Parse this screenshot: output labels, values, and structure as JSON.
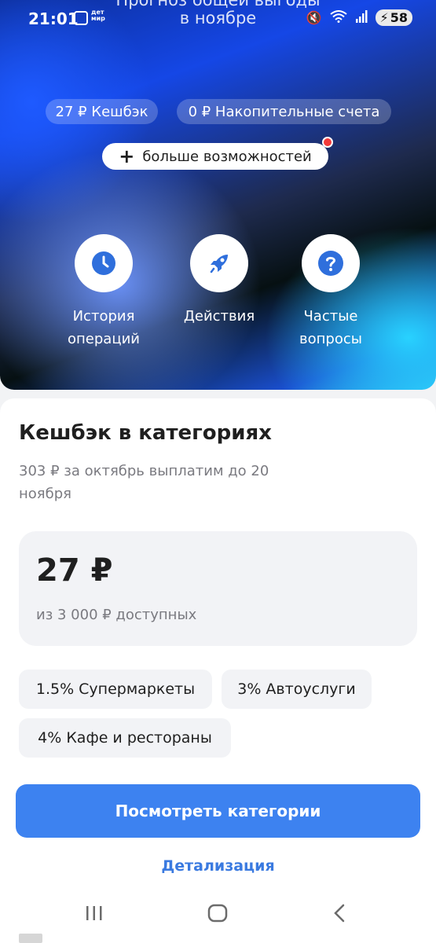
{
  "status_bar": {
    "time": "21:01",
    "logo_text": "дет мир",
    "battery": "58"
  },
  "behind_text": {
    "line1": "Прогноз общей выгоды",
    "line2": "в ноябре"
  },
  "chips": {
    "cashback": "27 ₽ Кешбэк",
    "savings": "0 ₽ Накопительные счета",
    "more": "больше возможностей"
  },
  "actions": [
    {
      "label": "История операций",
      "icon": "clock-icon"
    },
    {
      "label": "Действия",
      "icon": "rocket-icon"
    },
    {
      "label": "Частые вопросы",
      "icon": "question-icon"
    }
  ],
  "card": {
    "title": "Кешбэк в категориях",
    "subtitle": "303 ₽ за октябрь выплатим до 20 ноября",
    "amount": "27 ₽",
    "available": "из 3 000 ₽ доступных",
    "categories": [
      "1.5% Супермаркеты",
      "3% Автоуслуги",
      "4% Кафе и рестораны"
    ],
    "button": "Посмотреть категории",
    "link": "Детализация"
  },
  "colors": {
    "accent": "#3d82f0",
    "link": "#3a7ae0",
    "badge": "#f23a3a"
  }
}
